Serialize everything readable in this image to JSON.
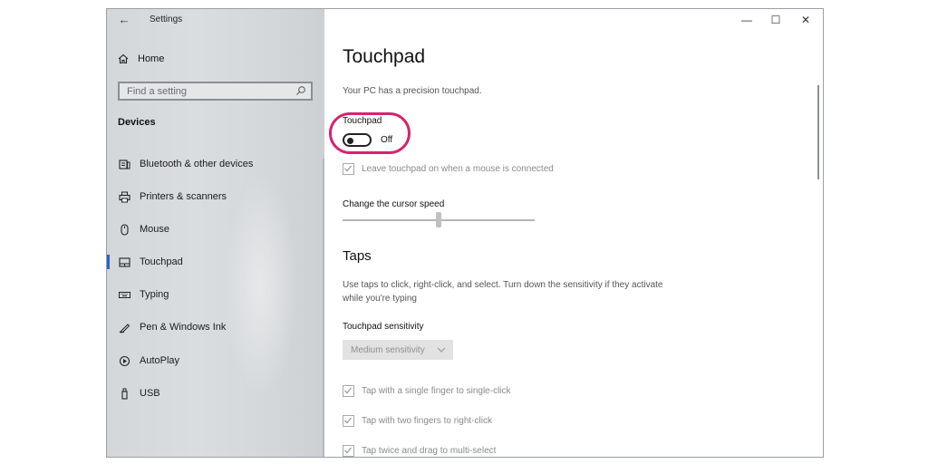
{
  "window": {
    "title": "Settings",
    "controls": {
      "minimize": "—",
      "maximize": "☐",
      "close": "✕"
    }
  },
  "sidebar": {
    "back_icon": "back-arrow-icon",
    "home_label": "Home",
    "search_placeholder": "Find a setting",
    "section_title": "Devices",
    "items": [
      {
        "label": "Bluetooth & other devices",
        "icon": "bluetooth-devices-icon",
        "active": false
      },
      {
        "label": "Printers & scanners",
        "icon": "printer-icon",
        "active": false
      },
      {
        "label": "Mouse",
        "icon": "mouse-icon",
        "active": false
      },
      {
        "label": "Touchpad",
        "icon": "touchpad-icon",
        "active": true
      },
      {
        "label": "Typing",
        "icon": "keyboard-icon",
        "active": false
      },
      {
        "label": "Pen & Windows Ink",
        "icon": "pen-icon",
        "active": false
      },
      {
        "label": "AutoPlay",
        "icon": "autoplay-icon",
        "active": false
      },
      {
        "label": "USB",
        "icon": "usb-icon",
        "active": false
      }
    ]
  },
  "main": {
    "title": "Touchpad",
    "description": "Your PC has a precision touchpad.",
    "touchpad_toggle": {
      "label": "Touchpad",
      "state": "Off"
    },
    "leave_on": {
      "label": "Leave touchpad on when a mouse is connected",
      "checked": true
    },
    "cursor_speed": {
      "label": "Change the cursor speed",
      "value_fraction": 0.5
    },
    "taps": {
      "heading": "Taps",
      "description": "Use taps to click, right-click, and select. Turn down the sensitivity if they activate while you're typing",
      "sensitivity_label": "Touchpad sensitivity",
      "sensitivity_value": "Medium sensitivity",
      "options": [
        {
          "label": "Tap with a single finger to single-click",
          "checked": true
        },
        {
          "label": "Tap with two fingers to right-click",
          "checked": true
        },
        {
          "label": "Tap twice and drag to multi-select",
          "checked": true
        }
      ]
    }
  },
  "colors": {
    "highlight": "#d6246e",
    "accent": "#2a66c0",
    "sidebar_bg": "#d8dbde"
  }
}
